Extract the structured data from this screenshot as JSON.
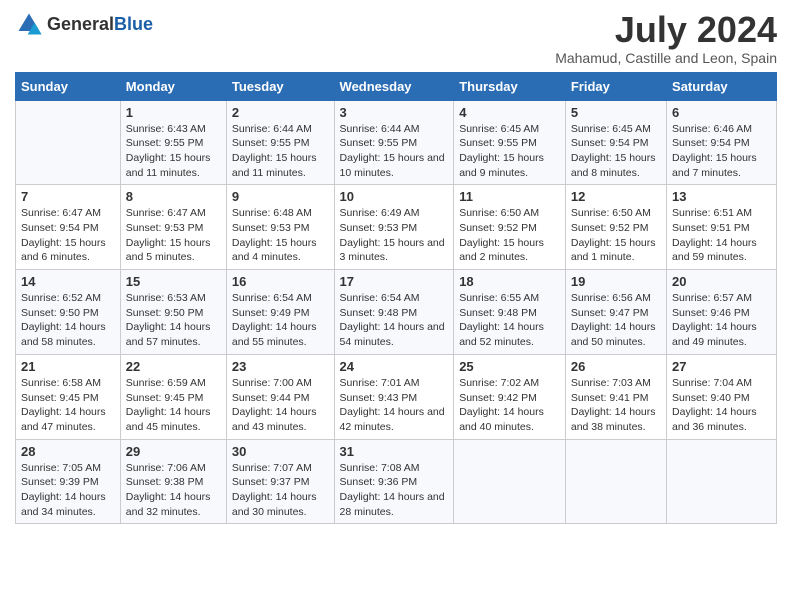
{
  "logo": {
    "general": "General",
    "blue": "Blue"
  },
  "title": "July 2024",
  "subtitle": "Mahamud, Castille and Leon, Spain",
  "weekdays": [
    "Sunday",
    "Monday",
    "Tuesday",
    "Wednesday",
    "Thursday",
    "Friday",
    "Saturday"
  ],
  "weeks": [
    [
      {
        "day": "",
        "sunrise": "",
        "sunset": "",
        "daylight": ""
      },
      {
        "day": "1",
        "sunrise": "Sunrise: 6:43 AM",
        "sunset": "Sunset: 9:55 PM",
        "daylight": "Daylight: 15 hours and 11 minutes."
      },
      {
        "day": "2",
        "sunrise": "Sunrise: 6:44 AM",
        "sunset": "Sunset: 9:55 PM",
        "daylight": "Daylight: 15 hours and 11 minutes."
      },
      {
        "day": "3",
        "sunrise": "Sunrise: 6:44 AM",
        "sunset": "Sunset: 9:55 PM",
        "daylight": "Daylight: 15 hours and 10 minutes."
      },
      {
        "day": "4",
        "sunrise": "Sunrise: 6:45 AM",
        "sunset": "Sunset: 9:55 PM",
        "daylight": "Daylight: 15 hours and 9 minutes."
      },
      {
        "day": "5",
        "sunrise": "Sunrise: 6:45 AM",
        "sunset": "Sunset: 9:54 PM",
        "daylight": "Daylight: 15 hours and 8 minutes."
      },
      {
        "day": "6",
        "sunrise": "Sunrise: 6:46 AM",
        "sunset": "Sunset: 9:54 PM",
        "daylight": "Daylight: 15 hours and 7 minutes."
      }
    ],
    [
      {
        "day": "7",
        "sunrise": "Sunrise: 6:47 AM",
        "sunset": "Sunset: 9:54 PM",
        "daylight": "Daylight: 15 hours and 6 minutes."
      },
      {
        "day": "8",
        "sunrise": "Sunrise: 6:47 AM",
        "sunset": "Sunset: 9:53 PM",
        "daylight": "Daylight: 15 hours and 5 minutes."
      },
      {
        "day": "9",
        "sunrise": "Sunrise: 6:48 AM",
        "sunset": "Sunset: 9:53 PM",
        "daylight": "Daylight: 15 hours and 4 minutes."
      },
      {
        "day": "10",
        "sunrise": "Sunrise: 6:49 AM",
        "sunset": "Sunset: 9:53 PM",
        "daylight": "Daylight: 15 hours and 3 minutes."
      },
      {
        "day": "11",
        "sunrise": "Sunrise: 6:50 AM",
        "sunset": "Sunset: 9:52 PM",
        "daylight": "Daylight: 15 hours and 2 minutes."
      },
      {
        "day": "12",
        "sunrise": "Sunrise: 6:50 AM",
        "sunset": "Sunset: 9:52 PM",
        "daylight": "Daylight: 15 hours and 1 minute."
      },
      {
        "day": "13",
        "sunrise": "Sunrise: 6:51 AM",
        "sunset": "Sunset: 9:51 PM",
        "daylight": "Daylight: 14 hours and 59 minutes."
      }
    ],
    [
      {
        "day": "14",
        "sunrise": "Sunrise: 6:52 AM",
        "sunset": "Sunset: 9:50 PM",
        "daylight": "Daylight: 14 hours and 58 minutes."
      },
      {
        "day": "15",
        "sunrise": "Sunrise: 6:53 AM",
        "sunset": "Sunset: 9:50 PM",
        "daylight": "Daylight: 14 hours and 57 minutes."
      },
      {
        "day": "16",
        "sunrise": "Sunrise: 6:54 AM",
        "sunset": "Sunset: 9:49 PM",
        "daylight": "Daylight: 14 hours and 55 minutes."
      },
      {
        "day": "17",
        "sunrise": "Sunrise: 6:54 AM",
        "sunset": "Sunset: 9:48 PM",
        "daylight": "Daylight: 14 hours and 54 minutes."
      },
      {
        "day": "18",
        "sunrise": "Sunrise: 6:55 AM",
        "sunset": "Sunset: 9:48 PM",
        "daylight": "Daylight: 14 hours and 52 minutes."
      },
      {
        "day": "19",
        "sunrise": "Sunrise: 6:56 AM",
        "sunset": "Sunset: 9:47 PM",
        "daylight": "Daylight: 14 hours and 50 minutes."
      },
      {
        "day": "20",
        "sunrise": "Sunrise: 6:57 AM",
        "sunset": "Sunset: 9:46 PM",
        "daylight": "Daylight: 14 hours and 49 minutes."
      }
    ],
    [
      {
        "day": "21",
        "sunrise": "Sunrise: 6:58 AM",
        "sunset": "Sunset: 9:45 PM",
        "daylight": "Daylight: 14 hours and 47 minutes."
      },
      {
        "day": "22",
        "sunrise": "Sunrise: 6:59 AM",
        "sunset": "Sunset: 9:45 PM",
        "daylight": "Daylight: 14 hours and 45 minutes."
      },
      {
        "day": "23",
        "sunrise": "Sunrise: 7:00 AM",
        "sunset": "Sunset: 9:44 PM",
        "daylight": "Daylight: 14 hours and 43 minutes."
      },
      {
        "day": "24",
        "sunrise": "Sunrise: 7:01 AM",
        "sunset": "Sunset: 9:43 PM",
        "daylight": "Daylight: 14 hours and 42 minutes."
      },
      {
        "day": "25",
        "sunrise": "Sunrise: 7:02 AM",
        "sunset": "Sunset: 9:42 PM",
        "daylight": "Daylight: 14 hours and 40 minutes."
      },
      {
        "day": "26",
        "sunrise": "Sunrise: 7:03 AM",
        "sunset": "Sunset: 9:41 PM",
        "daylight": "Daylight: 14 hours and 38 minutes."
      },
      {
        "day": "27",
        "sunrise": "Sunrise: 7:04 AM",
        "sunset": "Sunset: 9:40 PM",
        "daylight": "Daylight: 14 hours and 36 minutes."
      }
    ],
    [
      {
        "day": "28",
        "sunrise": "Sunrise: 7:05 AM",
        "sunset": "Sunset: 9:39 PM",
        "daylight": "Daylight: 14 hours and 34 minutes."
      },
      {
        "day": "29",
        "sunrise": "Sunrise: 7:06 AM",
        "sunset": "Sunset: 9:38 PM",
        "daylight": "Daylight: 14 hours and 32 minutes."
      },
      {
        "day": "30",
        "sunrise": "Sunrise: 7:07 AM",
        "sunset": "Sunset: 9:37 PM",
        "daylight": "Daylight: 14 hours and 30 minutes."
      },
      {
        "day": "31",
        "sunrise": "Sunrise: 7:08 AM",
        "sunset": "Sunset: 9:36 PM",
        "daylight": "Daylight: 14 hours and 28 minutes."
      },
      {
        "day": "",
        "sunrise": "",
        "sunset": "",
        "daylight": ""
      },
      {
        "day": "",
        "sunrise": "",
        "sunset": "",
        "daylight": ""
      },
      {
        "day": "",
        "sunrise": "",
        "sunset": "",
        "daylight": ""
      }
    ]
  ]
}
